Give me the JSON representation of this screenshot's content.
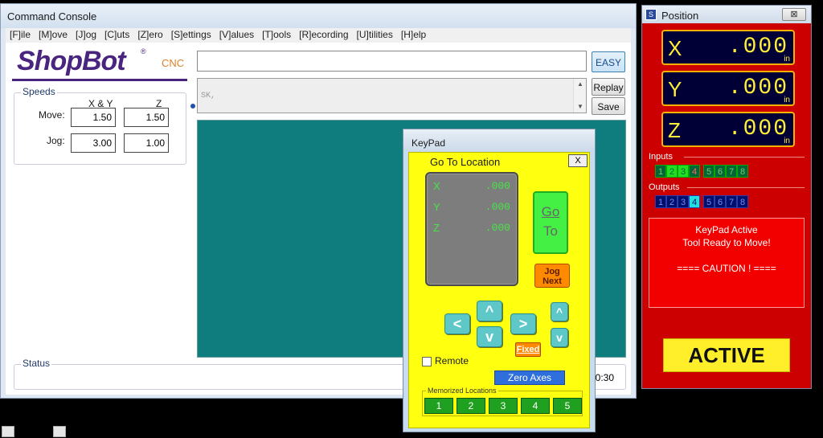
{
  "console": {
    "title": "Command Console",
    "menu": [
      "[F]ile",
      "[M]ove",
      "[J]og",
      "[C]uts",
      "[Z]ero",
      "[S]ettings",
      "[V]alues",
      "[T]ools",
      "[R]ecording",
      "[U]tilities",
      "[H]elp"
    ],
    "logo": {
      "text": "ShopBot",
      "reg": "®",
      "cnc": "CNC"
    },
    "speeds": {
      "legend": "Speeds",
      "col_xy": "X & Y",
      "col_z": "Z",
      "move_label": "Move:",
      "jog_label": "Jog:",
      "move_xy": "1.50",
      "move_z": "1.50",
      "jog_xy": "3.00",
      "jog_z": "1.00"
    },
    "command_value": "",
    "easy_label": "EASY",
    "replay_label": "Replay",
    "save_label": "Save",
    "history_text": "SK,",
    "status_legend": "Status",
    "status_time": "0:30"
  },
  "position": {
    "title": "Position",
    "close_label": "⊠",
    "axes": [
      {
        "name": "X",
        "value": ".000",
        "unit": "in"
      },
      {
        "name": "Y",
        "value": ".000",
        "unit": "in"
      },
      {
        "name": "Z",
        "value": ".000",
        "unit": "in"
      }
    ],
    "inputs_label": "Inputs",
    "outputs_label": "Outputs",
    "inputs": [
      "1",
      "2",
      "3",
      "4",
      "5",
      "6",
      "7",
      "8"
    ],
    "outputs": [
      "1",
      "2",
      "3",
      "4",
      "5",
      "6",
      "7",
      "8"
    ],
    "message": [
      "KeyPad Active",
      "Tool Ready to Move!",
      "",
      "==== CAUTION ! ===="
    ],
    "active_label": "ACTIVE"
  },
  "keypad": {
    "title": "KeyPad",
    "go_to_title": "Go To Location",
    "close_label": "X",
    "dro": [
      {
        "axis": "X",
        "value": ".000"
      },
      {
        "axis": "Y",
        "value": ".000"
      },
      {
        "axis": "Z",
        "value": ".000"
      }
    ],
    "go_line1": "Go",
    "go_line2": "To",
    "jog_next_line1": "Jog",
    "jog_next_line2": "Next",
    "up_label": "^",
    "down_label": "v",
    "left_label": "<",
    "right_label": ">",
    "z_up_label": "^",
    "z_down_label": "v",
    "fixed_label": "Fixed",
    "remote_label": "Remote",
    "zero_axes_label": "Zero Axes",
    "memorized_label": "Memorized Locations",
    "memory_slots": [
      "1",
      "2",
      "3",
      "4",
      "5"
    ]
  },
  "colors": {
    "position_bg": "#cc0000",
    "dro_text": "#ffef3a",
    "keypad_bg": "#ffff10",
    "teal_panel": "#0f7d7d",
    "io_active": "#22dd22",
    "output_active": "#22e0e0"
  }
}
